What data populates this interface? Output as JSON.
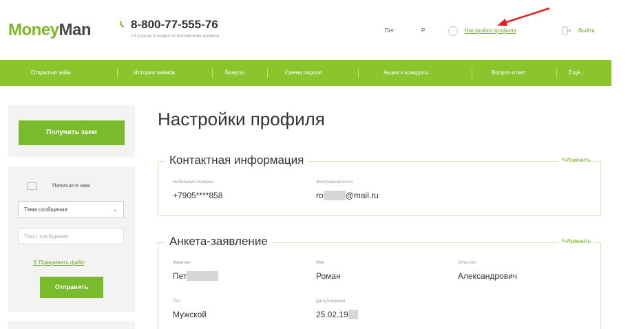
{
  "header": {
    "logo_part1": "Money",
    "logo_part2": "Man",
    "phone": "8-800-77-555-76",
    "phone_sub": "с 8 утра до 8 вечера по московскому времени",
    "user": "Пет",
    "initial": "Р.",
    "settings_link": "Настройки профиля",
    "logout_link": "Выйти",
    "icons": [
      "phone-icon",
      "gear-icon",
      "logout-icon",
      "red-arrow-icon"
    ]
  },
  "nav": {
    "items": [
      "Открытые займ",
      "История займов",
      "Бонусы",
      "Смена пароля",
      "Акции и конкурсы",
      "Вопрос-ответ",
      "Ещё..."
    ]
  },
  "sidebar": {
    "get_loan": "Получить заем",
    "write_us": "Напишите нам",
    "topic_select": "Тема сообщения",
    "message_placeholder": "Текст сообщения",
    "attach_file": "Прикрепить файл",
    "send": "Отправить"
  },
  "main": {
    "title": "Настройки профиля",
    "contact": {
      "legend": "Контактная информация",
      "edit": "Изменить",
      "phone_label": "Мобильный телефон",
      "phone_value": "+7905****858",
      "email_label": "Электронная почта",
      "email_prefix": "ro",
      "email_suffix": "@mail.ru"
    },
    "application": {
      "legend": "Анкета-заявление",
      "edit": "Изменить",
      "surname_label": "Фамилия",
      "surname_value": "Пет",
      "name_label": "Имя",
      "name_value": "Роман",
      "patronymic_label": "Отчество",
      "patronymic_value": "Александрович",
      "gender_label": "Пол",
      "gender_value": "Мужской",
      "birthdate_label": "Дата рождения",
      "birthdate_value": "25.02.19"
    }
  },
  "colors": {
    "brand_green": "#8ac52e",
    "button_green": "#79bb2c",
    "link_green": "#6aa820",
    "arrow_red": "#e02020"
  }
}
